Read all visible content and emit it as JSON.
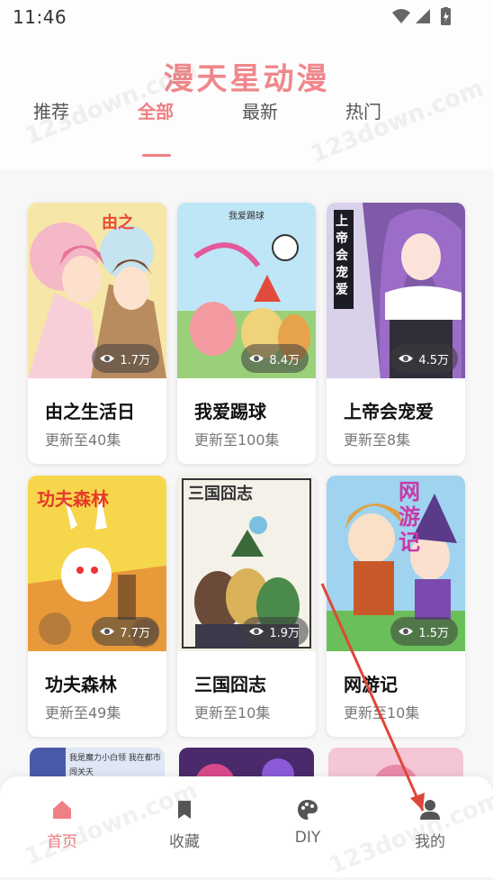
{
  "status_bar": {
    "time": "11:46"
  },
  "app": {
    "title": "漫天星动漫"
  },
  "tabs": [
    {
      "label": "推荐"
    },
    {
      "label": "全部"
    },
    {
      "label": "最新"
    },
    {
      "label": "热门"
    }
  ],
  "comics": [
    {
      "title": "由之生活日",
      "subtitle": "更新至40集",
      "views": "1.7万",
      "cover_text": ""
    },
    {
      "title": "我爱踢球",
      "subtitle": "更新至100集",
      "views": "8.4万",
      "cover_text": "我爱踢球"
    },
    {
      "title": "上帝会宠爱",
      "subtitle": "更新至8集",
      "views": "4.5万",
      "cover_text": "上帝会宠爱"
    },
    {
      "title": "功夫森林",
      "subtitle": "更新至49集",
      "views": "7.7万",
      "cover_text": "功夫森林"
    },
    {
      "title": "三国囧志",
      "subtitle": "更新至10集",
      "views": "1.9万",
      "cover_text": "三国囧志"
    },
    {
      "title": "网游记",
      "subtitle": "更新至10集",
      "views": "1.5万",
      "cover_text": "网游记"
    }
  ],
  "peek_row": {
    "first_cover_text": "我是魔力小白领 我在都市闯关天"
  },
  "bottom_nav": [
    {
      "label": "首页",
      "icon": "home-icon"
    },
    {
      "label": "收藏",
      "icon": "bookmark-icon"
    },
    {
      "label": "DIY",
      "icon": "palette-icon"
    },
    {
      "label": "我的",
      "icon": "person-icon"
    }
  ],
  "watermark": "123down.com",
  "colors": {
    "accent": "#ef7f84",
    "title": "#f0878b",
    "annotation_arrow": "#e0473a"
  }
}
